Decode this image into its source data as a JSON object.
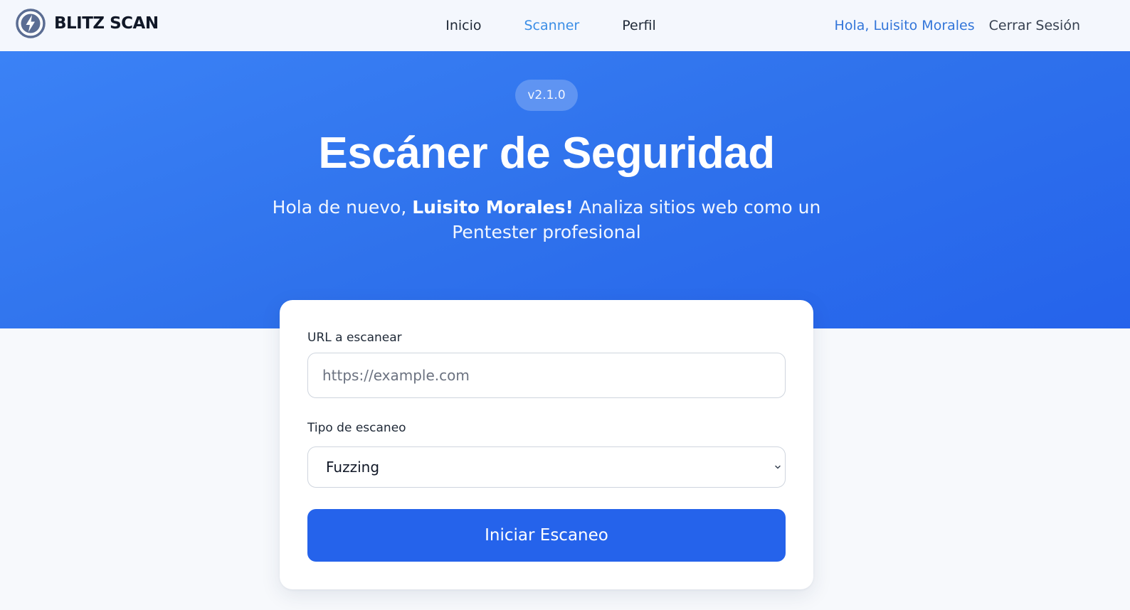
{
  "brand": {
    "name": "BLITZ SCAN",
    "logo_icon": "lightning-shield-icon"
  },
  "nav": {
    "links": [
      {
        "label": "Inicio",
        "active": false
      },
      {
        "label": "Scanner",
        "active": true
      },
      {
        "label": "Perfil",
        "active": false
      }
    ],
    "greeting": "Hola, Luisito Morales",
    "logout": "Cerrar Sesión"
  },
  "hero": {
    "version": "v2.1.0",
    "title": "Escáner de Seguridad",
    "subtitle_prefix": "Hola de nuevo,",
    "subtitle_name": "Luisito Morales!",
    "subtitle_suffix": "Analiza sitios web como un Pentester profesional"
  },
  "form": {
    "url_label": "URL a escanear",
    "url_placeholder": "https://example.com",
    "url_value": "",
    "type_label": "Tipo de escaneo",
    "type_selected": "Fuzzing",
    "submit_label": "Iniciar Escaneo"
  },
  "colors": {
    "accent": "#2563eb",
    "hero_gradient_start": "#3b82f6",
    "active_nav": "#3b8ee6",
    "greeting": "#3275d9"
  }
}
